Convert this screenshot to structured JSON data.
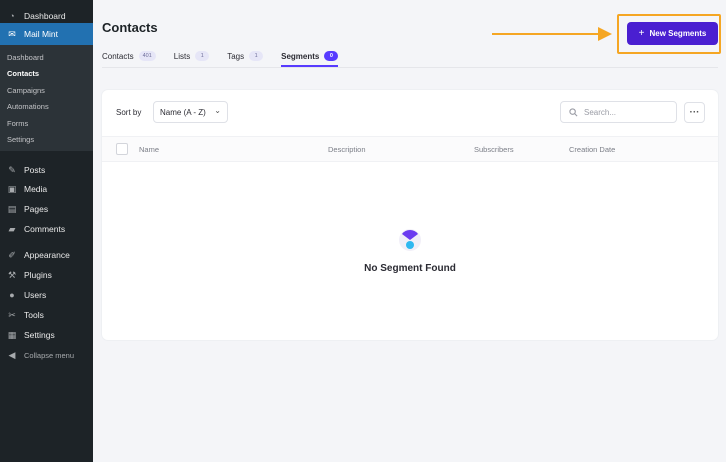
{
  "sidebar": {
    "items": [
      {
        "label": "Dashboard",
        "icon": "dashboard-icon"
      },
      {
        "label": "Mail Mint",
        "icon": "mail-icon"
      },
      {
        "label": "Posts",
        "icon": "pin-icon"
      },
      {
        "label": "Media",
        "icon": "media-icon"
      },
      {
        "label": "Pages",
        "icon": "page-icon"
      },
      {
        "label": "Comments",
        "icon": "comment-icon"
      },
      {
        "label": "Appearance",
        "icon": "brush-icon"
      },
      {
        "label": "Plugins",
        "icon": "plugin-icon"
      },
      {
        "label": "Users",
        "icon": "user-icon"
      },
      {
        "label": "Tools",
        "icon": "wrench-icon"
      },
      {
        "label": "Settings",
        "icon": "settings-icon"
      }
    ],
    "submenu": [
      "Dashboard",
      "Contacts",
      "Campaigns",
      "Automations",
      "Forms",
      "Settings"
    ],
    "collapse_label": "Collapse menu"
  },
  "page": {
    "title": "Contacts",
    "new_button_label": "New Segments"
  },
  "tabs": [
    {
      "label": "Contacts",
      "count": "401"
    },
    {
      "label": "Lists",
      "count": "1"
    },
    {
      "label": "Tags",
      "count": "1"
    },
    {
      "label": "Segments",
      "count": "0"
    }
  ],
  "toolbar": {
    "sort_label": "Sort by",
    "sort_value": "Name (A - Z)",
    "search_placeholder": "Search..."
  },
  "table": {
    "columns": [
      "Name",
      "Description",
      "Subscribers",
      "Creation Date"
    ]
  },
  "empty_state": {
    "message": "No Segment Found"
  },
  "colors": {
    "accent": "#573bff",
    "button": "#4a1fd1",
    "highlight": "#f5a623",
    "wp_active": "#2271b1"
  }
}
